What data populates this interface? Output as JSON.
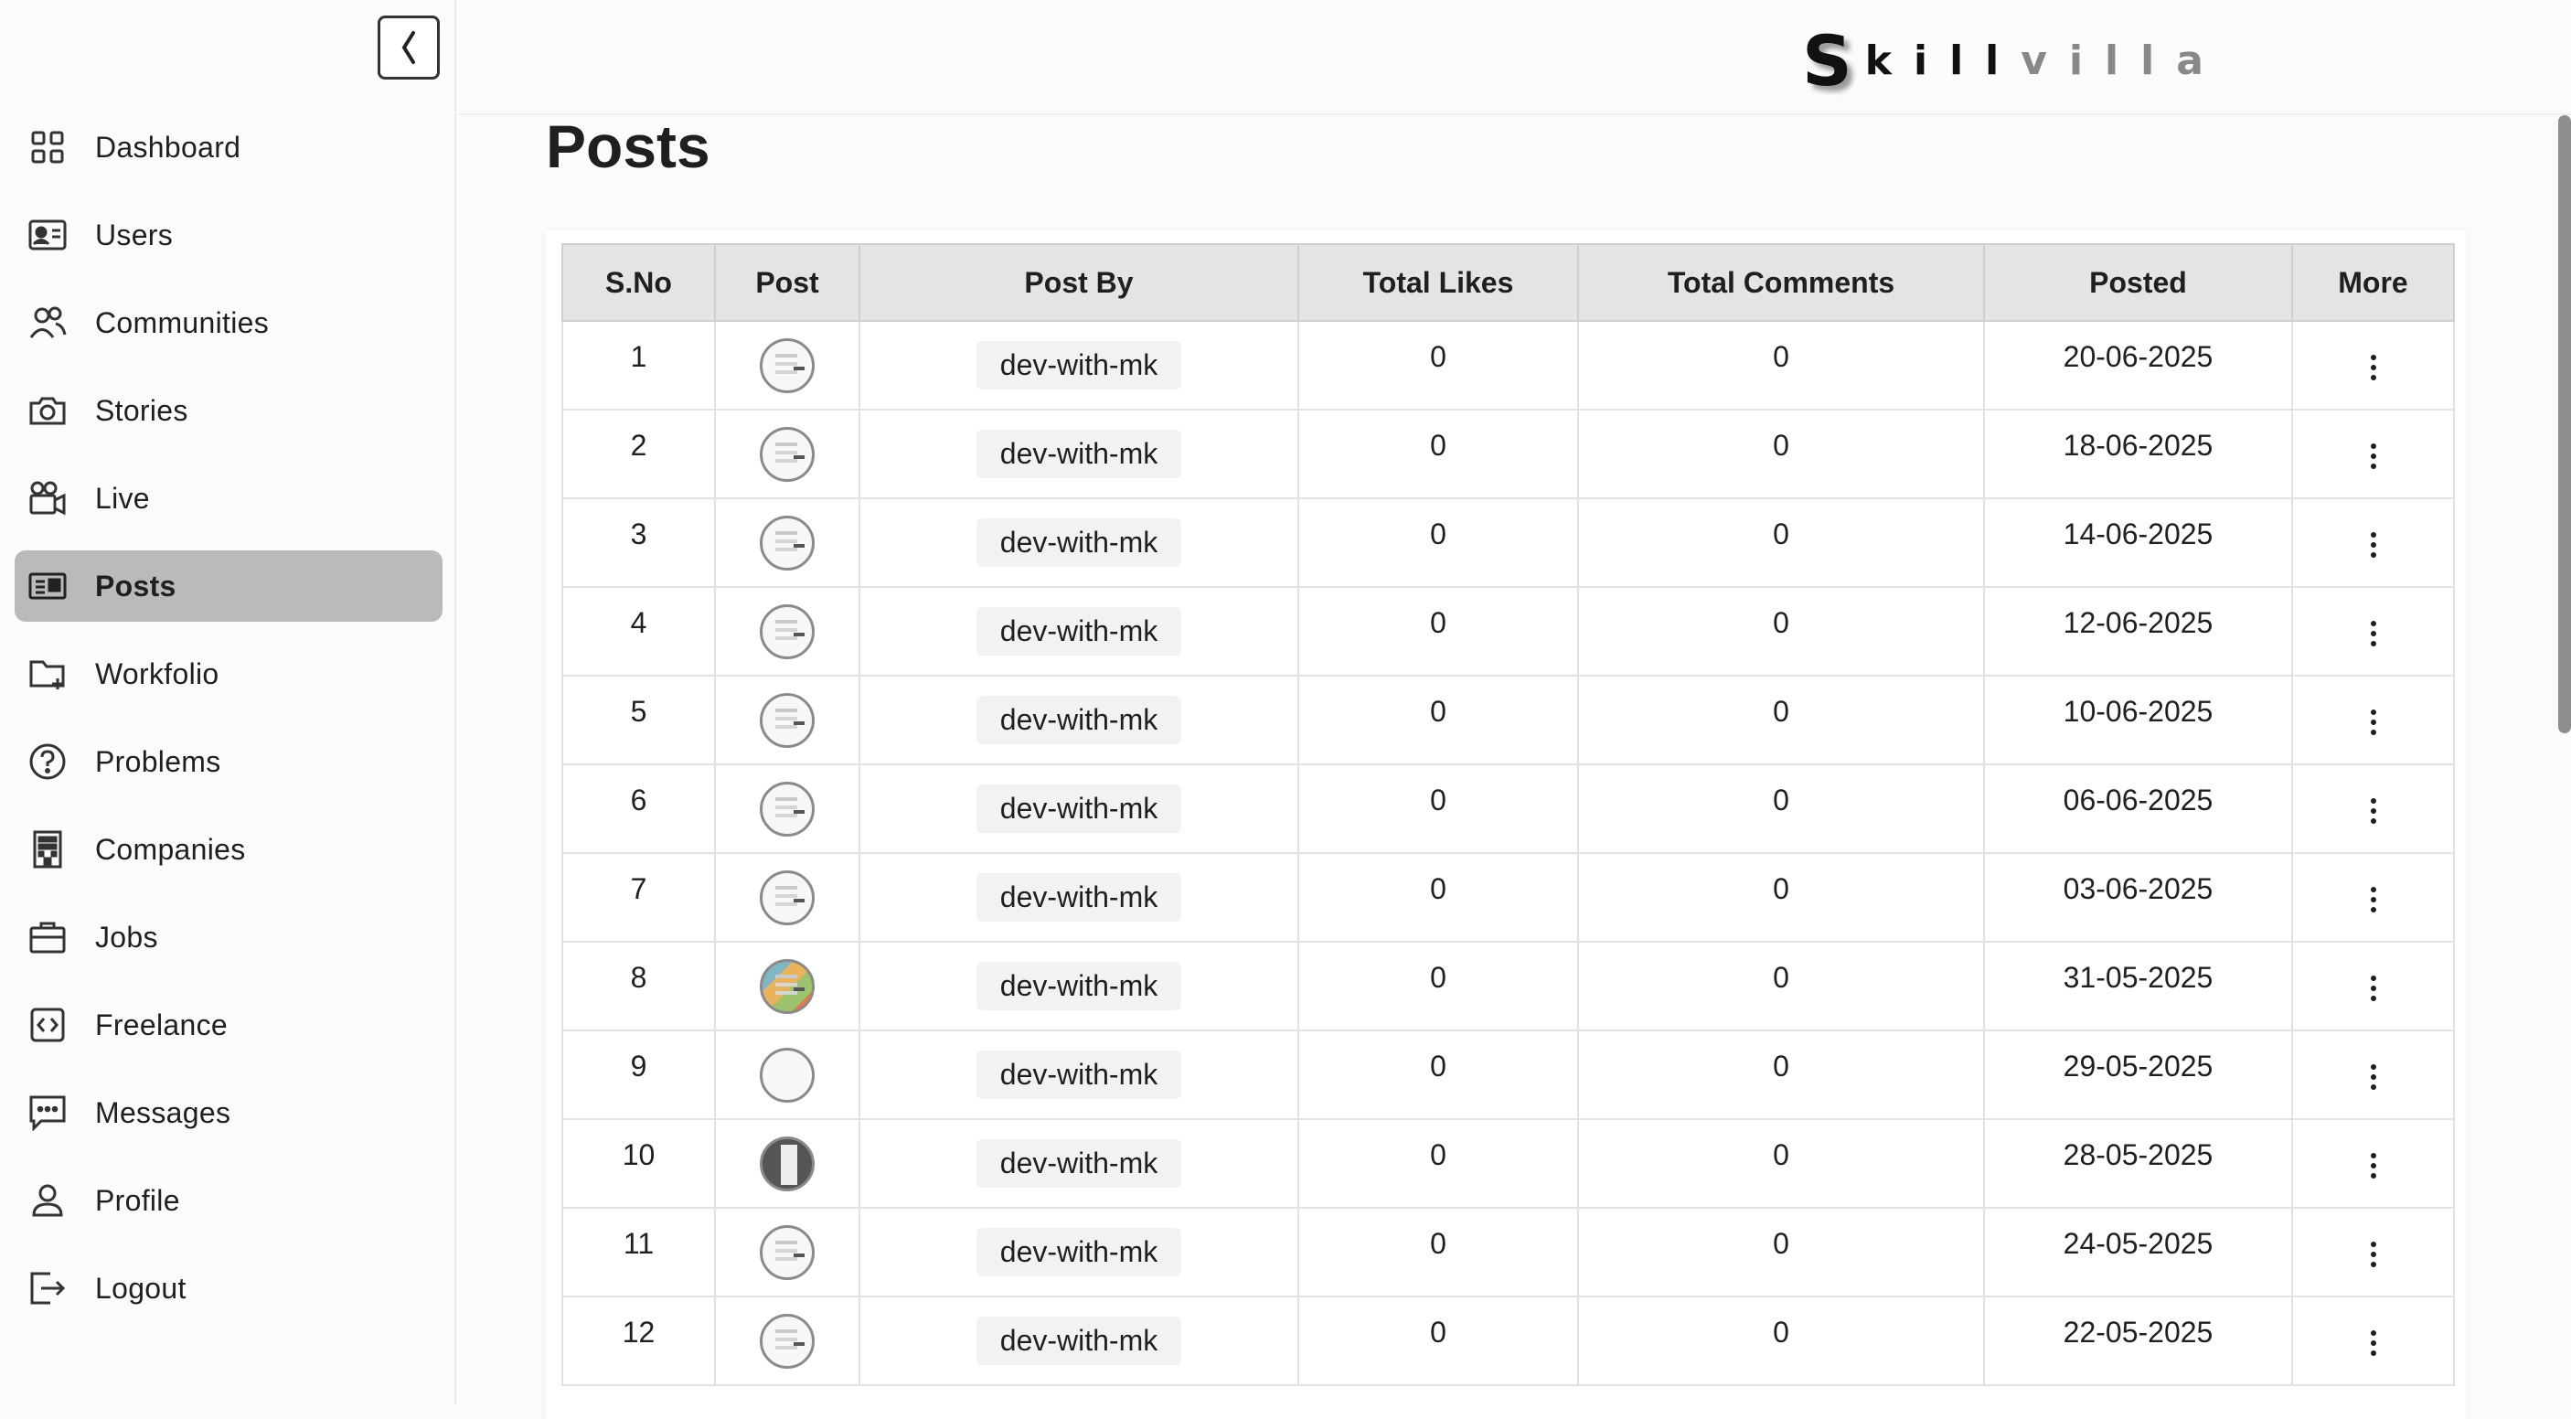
{
  "brand": {
    "logo_s": "S",
    "logo_kill": "kill",
    "logo_villa": "villa"
  },
  "sidebar": {
    "items": [
      {
        "label": "Dashboard",
        "icon": "grid-icon",
        "active": false
      },
      {
        "label": "Users",
        "icon": "id-card-icon",
        "active": false
      },
      {
        "label": "Communities",
        "icon": "people-icon",
        "active": false
      },
      {
        "label": "Stories",
        "icon": "camera-icon",
        "active": false
      },
      {
        "label": "Live",
        "icon": "video-camera-icon",
        "active": false
      },
      {
        "label": "Posts",
        "icon": "posts-icon",
        "active": true
      },
      {
        "label": "Workfolio",
        "icon": "folder-plus-icon",
        "active": false
      },
      {
        "label": "Problems",
        "icon": "question-circle-icon",
        "active": false
      },
      {
        "label": "Companies",
        "icon": "building-icon",
        "active": false
      },
      {
        "label": "Jobs",
        "icon": "briefcase-icon",
        "active": false
      },
      {
        "label": "Freelance",
        "icon": "code-icon",
        "active": false
      },
      {
        "label": "Messages",
        "icon": "message-icon",
        "active": false
      },
      {
        "label": "Profile",
        "icon": "person-icon",
        "active": false
      },
      {
        "label": "Logout",
        "icon": "logout-icon",
        "active": false
      }
    ]
  },
  "main": {
    "title": "Posts",
    "table": {
      "headers": [
        "S.No",
        "Post",
        "Post By",
        "Total Likes",
        "Total Comments",
        "Posted",
        "More"
      ],
      "rows": [
        {
          "sno": "1",
          "by": "dev-with-mk",
          "likes": "0",
          "comments": "0",
          "posted": "20-06-2025"
        },
        {
          "sno": "2",
          "by": "dev-with-mk",
          "likes": "0",
          "comments": "0",
          "posted": "18-06-2025"
        },
        {
          "sno": "3",
          "by": "dev-with-mk",
          "likes": "0",
          "comments": "0",
          "posted": "14-06-2025"
        },
        {
          "sno": "4",
          "by": "dev-with-mk",
          "likes": "0",
          "comments": "0",
          "posted": "12-06-2025"
        },
        {
          "sno": "5",
          "by": "dev-with-mk",
          "likes": "0",
          "comments": "0",
          "posted": "10-06-2025"
        },
        {
          "sno": "6",
          "by": "dev-with-mk",
          "likes": "0",
          "comments": "0",
          "posted": "06-06-2025"
        },
        {
          "sno": "7",
          "by": "dev-with-mk",
          "likes": "0",
          "comments": "0",
          "posted": "03-06-2025"
        },
        {
          "sno": "8",
          "by": "dev-with-mk",
          "likes": "0",
          "comments": "0",
          "posted": "31-05-2025"
        },
        {
          "sno": "9",
          "by": "dev-with-mk",
          "likes": "0",
          "comments": "0",
          "posted": "29-05-2025"
        },
        {
          "sno": "10",
          "by": "dev-with-mk",
          "likes": "0",
          "comments": "0",
          "posted": "28-05-2025"
        },
        {
          "sno": "11",
          "by": "dev-with-mk",
          "likes": "0",
          "comments": "0",
          "posted": "24-05-2025"
        },
        {
          "sno": "12",
          "by": "dev-with-mk",
          "likes": "0",
          "comments": "0",
          "posted": "22-05-2025"
        }
      ]
    }
  },
  "colors": {
    "active_nav": "#bcbab9",
    "header_bg": "#e4e4e4",
    "page_bg": "#fcfbfa"
  }
}
